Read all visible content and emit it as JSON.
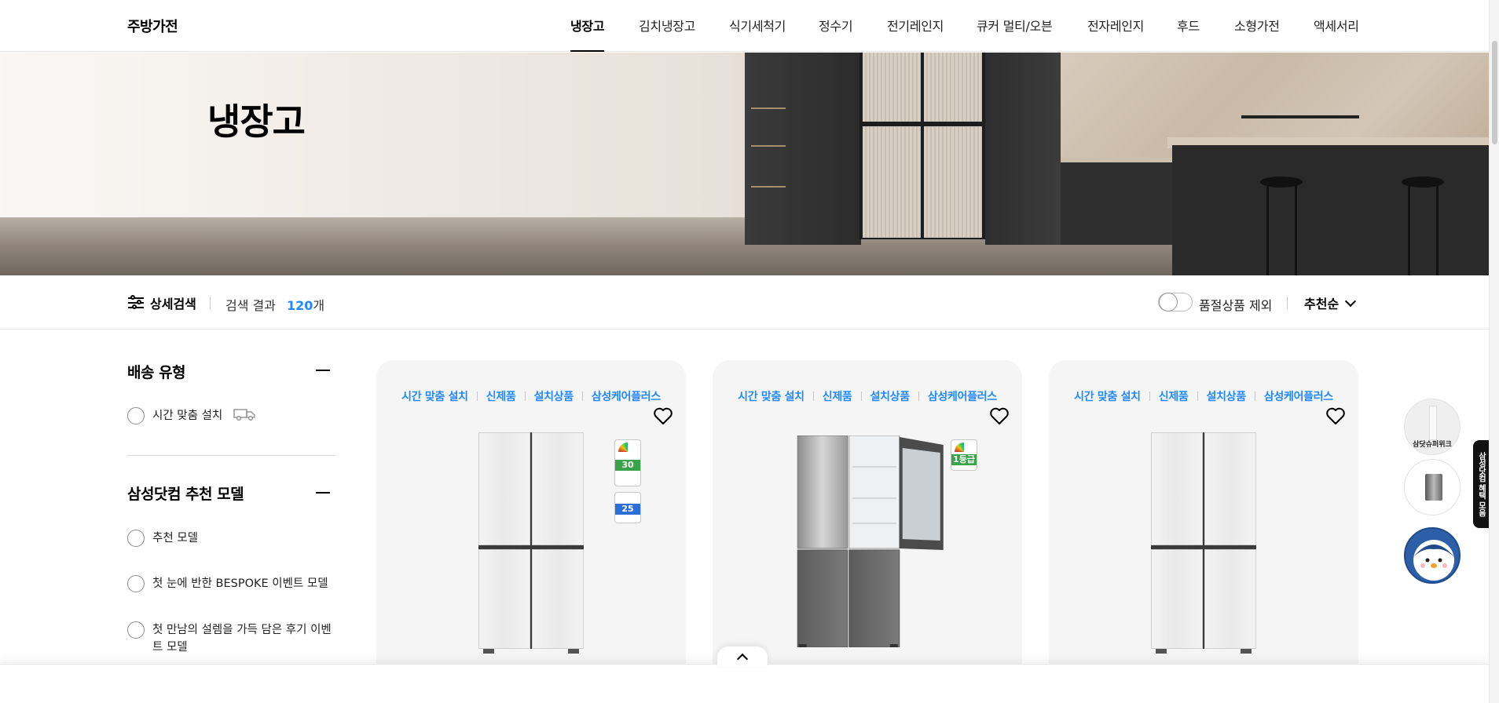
{
  "header": {
    "brand": "주방가전",
    "nav": [
      {
        "label": "냉장고",
        "active": true
      },
      {
        "label": "김치냉장고",
        "active": false
      },
      {
        "label": "식기세척기",
        "active": false
      },
      {
        "label": "정수기",
        "active": false
      },
      {
        "label": "전기레인지",
        "active": false
      },
      {
        "label": "큐커 멀티/오븐",
        "active": false
      },
      {
        "label": "전자레인지",
        "active": false
      },
      {
        "label": "후드",
        "active": false
      },
      {
        "label": "소형가전",
        "active": false
      },
      {
        "label": "액세서리",
        "active": false
      }
    ]
  },
  "hero": {
    "title": "냉장고"
  },
  "filterbar": {
    "detail_search": "상세검색",
    "result_label": "검색 결과",
    "result_count": "120",
    "result_unit": "개",
    "exclude_soldout": "품절상품 제외",
    "sort": "추천순"
  },
  "sidebar": {
    "delivery": {
      "title": "배송 유형",
      "options": [
        "시간 맞춤 설치"
      ]
    },
    "recommend": {
      "title": "삼성닷컴 추천 모델",
      "options": [
        "추천 모델",
        "첫 눈에 반한 BESPOKE 이벤트 모델",
        "첫 만남의 설렘을 가득 담은 후기 이벤트 모델"
      ]
    }
  },
  "products": [
    {
      "tags": [
        "시간 맞춤 설치",
        "신제품",
        "설치상품",
        "삼성케어플러스"
      ],
      "badges": [
        "30",
        "25"
      ]
    },
    {
      "tags": [
        "시간 맞춤 설치",
        "신제품",
        "설치상품",
        "삼성케어플러스"
      ],
      "badges": [
        "1등급"
      ]
    },
    {
      "tags": [
        "시간 맞춤 설치",
        "신제품",
        "설치상품",
        "삼성케어플러스"
      ],
      "badges": []
    }
  ],
  "floating": {
    "super_week": "삼닷슈퍼위크",
    "side_tab": "삼성닷컴 혜택 모음"
  },
  "colors": {
    "accent": "#2189ff",
    "card_bg": "#f5f5f5",
    "energy_green": "#3aa34a",
    "badge_blue": "#2b6fd6"
  }
}
